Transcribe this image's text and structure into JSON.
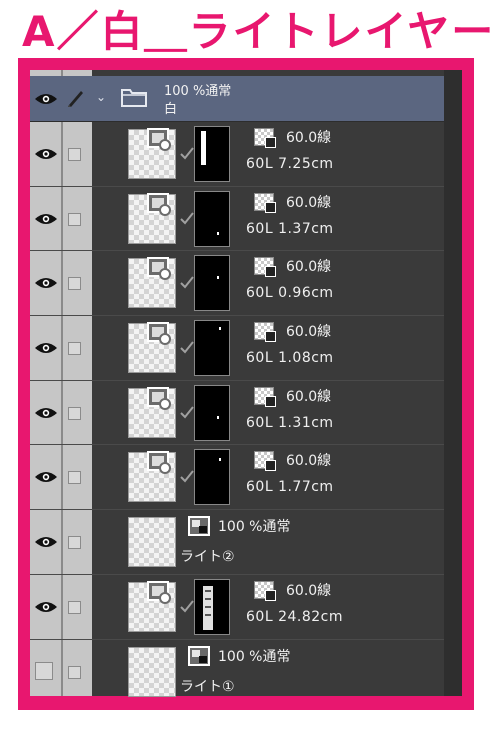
{
  "title": "A／白＿ライトレイヤー",
  "colors": {
    "accent": "#e8176f",
    "panel": "#3a3a3a",
    "folder": "#5b6680"
  },
  "folder": {
    "opacity_blend": "100 %通常",
    "name": "白"
  },
  "layers": [
    {
      "type": "vector",
      "opacity": "60.0線",
      "info": "60L 7.25cm"
    },
    {
      "type": "vector",
      "opacity": "60.0線",
      "info": "60L 1.37cm"
    },
    {
      "type": "vector",
      "opacity": "60.0線",
      "info": "60L 0.96cm"
    },
    {
      "type": "vector",
      "opacity": "60.0線",
      "info": "60L 1.08cm"
    },
    {
      "type": "vector",
      "opacity": "60.0線",
      "info": "60L 1.31cm"
    },
    {
      "type": "vector",
      "opacity": "60.0線",
      "info": "60L 1.77cm"
    },
    {
      "type": "raster",
      "blend": "100 %通常",
      "name": "ライト②"
    },
    {
      "type": "vector",
      "opacity": "60.0線",
      "info": "60L 24.82cm"
    },
    {
      "type": "raster",
      "blend": "100 %通常",
      "name": "ライト①"
    }
  ],
  "icons": {
    "eye": "eye-icon",
    "pen": "pen-icon",
    "folder": "folder-icon",
    "chevron": "chevron-down-icon"
  }
}
